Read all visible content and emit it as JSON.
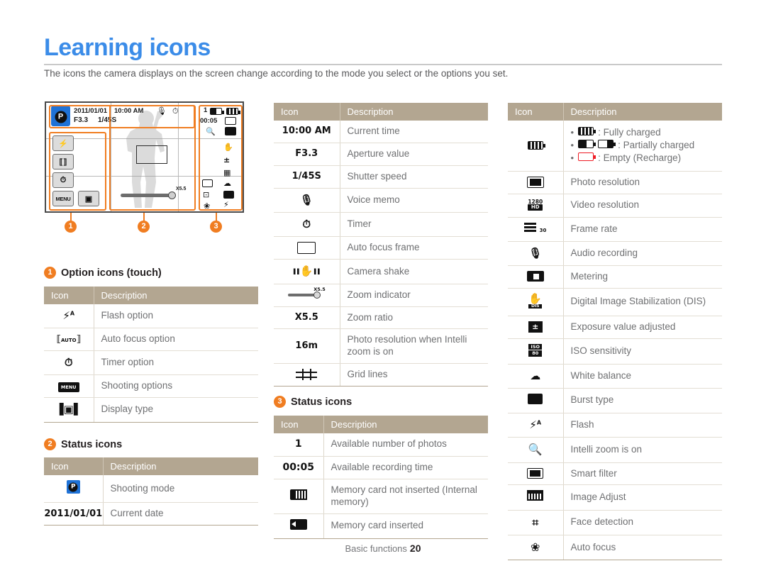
{
  "header": {
    "title": "Learning icons",
    "subtitle": "The icons the camera displays on the screen change according to the mode you select or the options you set."
  },
  "camera_screen": {
    "date": "2011/01/01",
    "time": "10:00 AM",
    "aperture": "F3.3",
    "shutter": "1/45S",
    "available_photos": "1",
    "recording_time": "00:05",
    "zoom_ratio": "X5.5",
    "mode_letter": "P",
    "menu_label": "MENU",
    "callouts": [
      "1",
      "2",
      "3"
    ]
  },
  "sections": {
    "option_icons": {
      "number": "1",
      "label": "Option icons (touch)"
    },
    "status_icons_2": {
      "number": "2",
      "label": "Status icons"
    },
    "status_icons_3": {
      "number": "3",
      "label": "Status icons"
    }
  },
  "table_headers": {
    "icon": "Icon",
    "description": "Description"
  },
  "tables": {
    "option_icons": [
      {
        "icon": "flash-auto-icon",
        "desc": "Flash option"
      },
      {
        "icon": "auto-focus-icon",
        "desc": "Auto focus option"
      },
      {
        "icon": "timer-icon",
        "desc": "Timer option"
      },
      {
        "icon": "menu-icon",
        "desc": "Shooting options"
      },
      {
        "icon": "display-type-icon",
        "desc": "Display type"
      }
    ],
    "status_icons_left": [
      {
        "icon": "shooting-mode-icon",
        "desc": "Shooting mode"
      },
      {
        "icon": "2011/01/01",
        "desc": "Current date"
      }
    ],
    "middle": [
      {
        "icon": "10:00 AM",
        "desc": "Current time"
      },
      {
        "icon": "F3.3",
        "desc": "Aperture value"
      },
      {
        "icon": "1/45S",
        "desc": "Shutter speed"
      },
      {
        "icon": "voice-memo-icon",
        "desc": "Voice memo"
      },
      {
        "icon": "timer-icon",
        "desc": "Timer"
      },
      {
        "icon": "auto-focus-frame-icon",
        "desc": "Auto focus frame"
      },
      {
        "icon": "camera-shake-icon",
        "desc": "Camera shake"
      },
      {
        "icon": "zoom-indicator-icon",
        "desc": "Zoom indicator"
      },
      {
        "icon": "X5.5",
        "desc": "Zoom ratio"
      },
      {
        "icon": "16m",
        "desc": "Photo resolution when Intelli zoom is on"
      },
      {
        "icon": "grid-lines-icon",
        "desc": "Grid lines"
      }
    ],
    "status_icons_middle": [
      {
        "icon": "1",
        "desc": "Available number of photos"
      },
      {
        "icon": "00:05",
        "desc": "Available recording time"
      },
      {
        "icon": "memory-card-not-inserted-icon",
        "desc": "Memory card not inserted (Internal memory)"
      },
      {
        "icon": "memory-card-inserted-icon",
        "desc": "Memory card inserted"
      }
    ],
    "right": [
      {
        "icon": "battery-icon",
        "bullets": [
          {
            "icons": [
              "battery-full-icon"
            ],
            "text": ": Fully charged"
          },
          {
            "icons": [
              "battery-half-icon",
              "battery-low-icon"
            ],
            "text": ": Partially charged"
          },
          {
            "icons": [
              "battery-empty-icon"
            ],
            "text": ": Empty (Recharge)"
          }
        ]
      },
      {
        "icon": "photo-resolution-icon",
        "desc": "Photo resolution"
      },
      {
        "icon": "video-resolution-icon",
        "desc": "Video resolution",
        "icon_text": "1280",
        "icon_sub": "HD"
      },
      {
        "icon": "frame-rate-icon",
        "desc": "Frame rate",
        "icon_sub": "30"
      },
      {
        "icon": "audio-recording-icon",
        "desc": "Audio recording"
      },
      {
        "icon": "metering-icon",
        "desc": "Metering"
      },
      {
        "icon": "dis-icon",
        "desc": "Digital Image Stabilization (DIS)"
      },
      {
        "icon": "exposure-value-icon",
        "desc": "Exposure value adjusted"
      },
      {
        "icon": "iso-icon",
        "desc": "ISO sensitivity",
        "icon_text": "ISO",
        "icon_sub": "80"
      },
      {
        "icon": "white-balance-icon",
        "desc": "White balance"
      },
      {
        "icon": "burst-type-icon",
        "desc": "Burst type"
      },
      {
        "icon": "flash-icon",
        "desc": "Flash"
      },
      {
        "icon": "intelli-zoom-icon",
        "desc": "Intelli zoom is on"
      },
      {
        "icon": "smart-filter-icon",
        "desc": "Smart filter"
      },
      {
        "icon": "image-adjust-icon",
        "desc": "Image Adjust"
      },
      {
        "icon": "face-detection-icon",
        "desc": "Face detection"
      },
      {
        "icon": "auto-focus-macro-icon",
        "desc": "Auto focus"
      }
    ]
  },
  "footer": {
    "section": "Basic functions",
    "page": "20"
  },
  "colors": {
    "title": "#3b8ce8",
    "accent": "#f07d21",
    "table_header": "#b3a691",
    "body_text": "#6f7072"
  }
}
